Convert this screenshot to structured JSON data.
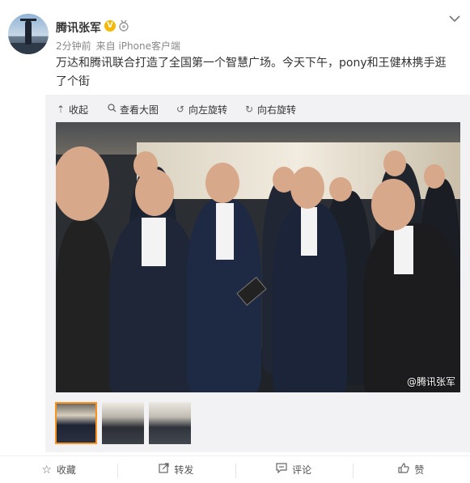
{
  "post": {
    "username": "腾讯张军",
    "verified_badge": "V",
    "time": "2分钟前",
    "source": "来自 iPhone客户端",
    "text": "万达和腾讯联合打造了全国第一个智慧广场。今天下午，pony和王健林携手逛了个街"
  },
  "media_toolbar": {
    "collapse": "收起",
    "view_large": "查看大图",
    "rotate_left": "向左旋转",
    "rotate_right": "向右旋转"
  },
  "photo": {
    "watermark": "@腾讯张军"
  },
  "thumbnails": [
    {
      "selected": true
    },
    {
      "selected": false
    },
    {
      "selected": false
    }
  ],
  "actions": {
    "favorite": "收藏",
    "repost": "转发",
    "comment": "评论",
    "like": "赞"
  },
  "icons": {
    "collapse": "arrow-up-icon",
    "view_large": "magnifier-icon",
    "rotate_left": "rotate-left-icon",
    "rotate_right": "rotate-right-icon",
    "favorite": "star-icon",
    "repost": "repost-icon",
    "comment": "comment-icon",
    "like": "thumb-up-icon",
    "menu": "chevron-down-icon"
  },
  "colors": {
    "verified": "#f6b800",
    "thumb_selected_border": "#f7931e",
    "media_bg": "#f2f2f5"
  }
}
